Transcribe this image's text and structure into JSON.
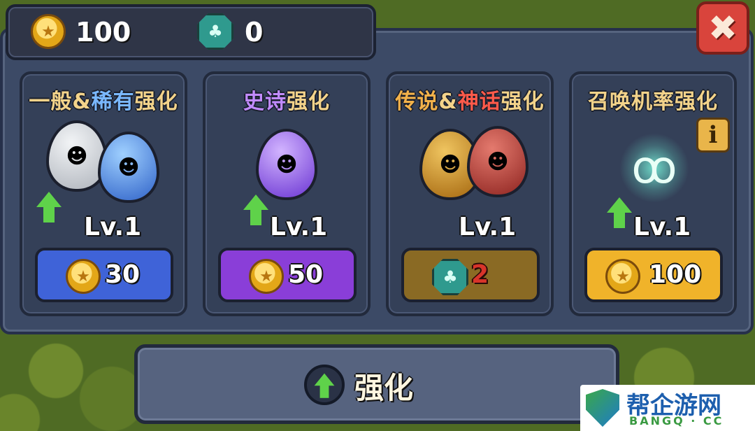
{
  "currency": {
    "coins": "100",
    "gems": "0"
  },
  "close_label": "✖",
  "cards": [
    {
      "title_parts": [
        {
          "text": "一般",
          "color": "#f3d38a"
        },
        {
          "text": "&",
          "color": "#f3d38a"
        },
        {
          "text": "稀有",
          "color": "#7ab8ff"
        },
        {
          "text": "强化",
          "color": "#f3d38a"
        }
      ],
      "level": "Lv.1",
      "cost": "30",
      "cost_currency": "coin",
      "button_color": "#3f63d8",
      "eggs": [
        "#c9cdd3",
        "#3f7fe0"
      ]
    },
    {
      "title_parts": [
        {
          "text": "史诗",
          "color": "#c28bff"
        },
        {
          "text": "强化",
          "color": "#f3d38a"
        }
      ],
      "level": "Lv.1",
      "cost": "50",
      "cost_currency": "coin",
      "button_color": "#8a3ed8",
      "eggs": [
        "#8b5ae6"
      ]
    },
    {
      "title_parts": [
        {
          "text": "传说",
          "color": "#f3b24a"
        },
        {
          "text": "&",
          "color": "#f3d38a"
        },
        {
          "text": "神话",
          "color": "#ff5a4a"
        },
        {
          "text": "强化",
          "color": "#f3d38a"
        }
      ],
      "level": "Lv.1",
      "cost": "2",
      "cost_currency": "gem",
      "button_color": "#8a6a24",
      "eggs": [
        "#d08e22",
        "#b83a34"
      ]
    },
    {
      "title_parts": [
        {
          "text": "召唤机率强化",
          "color": "#f3d38a"
        }
      ],
      "level": "Lv.1",
      "cost": "100",
      "cost_currency": "coin",
      "button_color": "#f0b32a",
      "info_label": "i"
    }
  ],
  "main_button_label": "强化",
  "watermark": {
    "title": "帮企游网",
    "sub": "BANGQ · CC"
  }
}
